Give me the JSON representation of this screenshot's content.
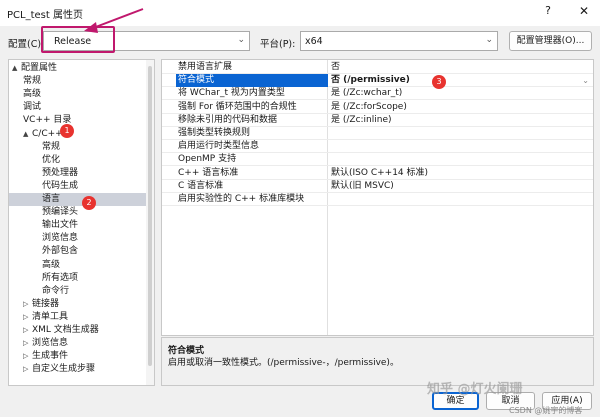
{
  "window": {
    "title": "PCL_test 属性页",
    "help_glyph": "?",
    "close_glyph": "✕"
  },
  "config": {
    "label": "配置(C):",
    "value": "Release",
    "chevron": "⌄"
  },
  "platform": {
    "label": "平台(P):",
    "value": "x64",
    "chevron": "⌄"
  },
  "config_manager_label": "配置管理器(O)...",
  "annotation_colors": {
    "highlight": "#c0186d",
    "badge": "#e8332f",
    "selection": "#0a64d2"
  },
  "badges": [
    "1",
    "2",
    "3"
  ],
  "tree": [
    {
      "label": "配置属性",
      "arrow": "▲"
    },
    {
      "label": "常规"
    },
    {
      "label": "高级"
    },
    {
      "label": "调试"
    },
    {
      "label": "VC++ 目录"
    },
    {
      "label": "C/C++",
      "arrow": "▲"
    },
    {
      "label": "常规"
    },
    {
      "label": "优化"
    },
    {
      "label": "预处理器"
    },
    {
      "label": "代码生成"
    },
    {
      "label": "语言"
    },
    {
      "label": "预编译头"
    },
    {
      "label": "输出文件"
    },
    {
      "label": "浏览信息"
    },
    {
      "label": "外部包含"
    },
    {
      "label": "高级"
    },
    {
      "label": "所有选项"
    },
    {
      "label": "命令行"
    },
    {
      "label": "链接器",
      "arrow": "▷"
    },
    {
      "label": "清单工具",
      "arrow": "▷"
    },
    {
      "label": "XML 文档生成器",
      "arrow": "▷"
    },
    {
      "label": "浏览信息",
      "arrow": "▷"
    },
    {
      "label": "生成事件",
      "arrow": "▷"
    },
    {
      "label": "自定义生成步骤",
      "arrow": "▷"
    }
  ],
  "properties": [
    {
      "name": "禁用语言扩展",
      "value": "否"
    },
    {
      "name": "符合模式",
      "value": "否 (/permissive)"
    },
    {
      "name": "将 WChar_t 视为内置类型",
      "value": "是 (/Zc:wchar_t)"
    },
    {
      "name": "强制 For 循环范围中的合规性",
      "value": "是 (/Zc:forScope)"
    },
    {
      "name": "移除未引用的代码和数据",
      "value": "是 (/Zc:inline)"
    },
    {
      "name": "强制类型转换规则",
      "value": ""
    },
    {
      "name": "启用运行时类型信息",
      "value": ""
    },
    {
      "name": "OpenMP 支持",
      "value": ""
    },
    {
      "name": "C++ 语言标准",
      "value": "默认(ISO C++14 标准)"
    },
    {
      "name": "C 语言标准",
      "value": "默认(旧 MSVC)"
    },
    {
      "name": "启用实验性的 C++ 标准库模块",
      "value": ""
    }
  ],
  "description": {
    "title": "符合模式",
    "text": "启用或取消一致性模式。(/permissive-，/permissive)。"
  },
  "buttons": {
    "ok": "确定",
    "cancel": "取消",
    "apply": "应用(A)"
  },
  "watermark": {
    "main": "知乎 @灯火阑珊",
    "csdn": "CSDN @姚宇的博客"
  }
}
